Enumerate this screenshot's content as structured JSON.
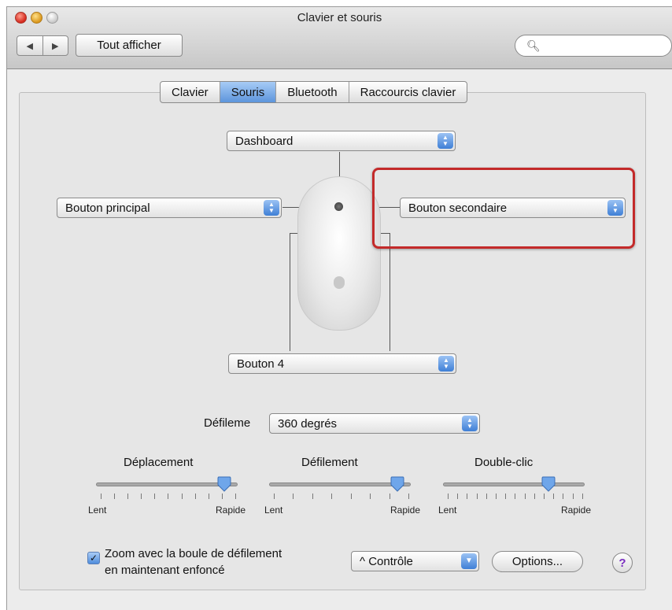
{
  "window": {
    "title": "Clavier et souris"
  },
  "toolbar": {
    "show_all_label": "Tout afficher",
    "search": {
      "value": ""
    }
  },
  "tabs": [
    {
      "label": "Clavier",
      "active": false
    },
    {
      "label": "Souris",
      "active": true
    },
    {
      "label": "Bluetooth",
      "active": false
    },
    {
      "label": "Raccourcis clavier",
      "active": false
    }
  ],
  "mouse_buttons": {
    "top": "Dashboard",
    "left": "Bouton principal",
    "right": "Bouton secondaire",
    "bottom": "Bouton 4"
  },
  "scroll": {
    "label": "Défileme",
    "value": "360 degrés"
  },
  "sliders": [
    {
      "label": "Déplacement",
      "min_label": "Lent",
      "max_label": "Rapide",
      "level": 0.95
    },
    {
      "label": "Défilement",
      "min_label": "Lent",
      "max_label": "Rapide",
      "level": 0.95
    },
    {
      "label": "Double-clic",
      "min_label": "Lent",
      "max_label": "Rapide",
      "level": 0.77
    }
  ],
  "zoom": {
    "checked": true,
    "label_line1": "Zoom avec la boule de défilement",
    "label_line2": "en maintenant enfoncé",
    "modifier": "^ Contrôle",
    "options_label": "Options...",
    "help_label": "?"
  },
  "colors": {
    "highlight": "#c32a2a",
    "accent": "#4f8ddc"
  }
}
